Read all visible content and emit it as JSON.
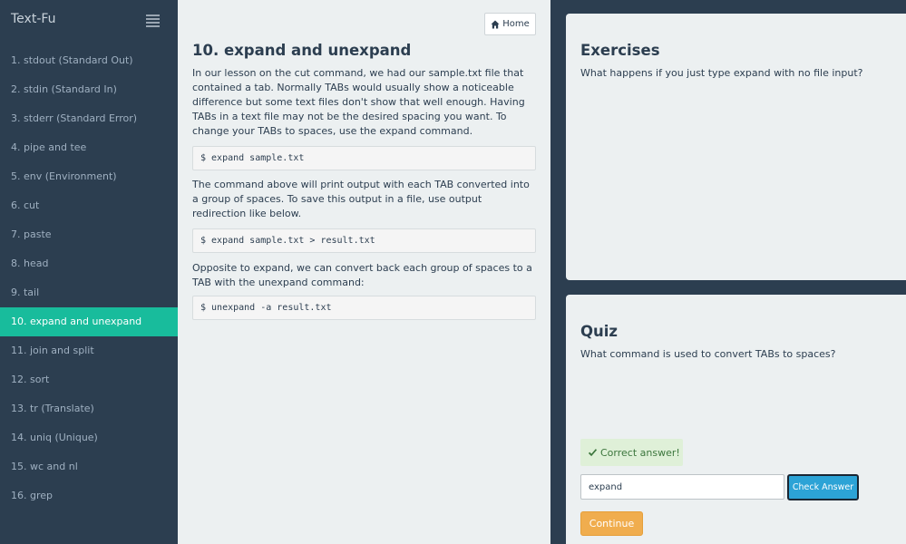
{
  "app": {
    "brand": "Text-Fu"
  },
  "sidebar": {
    "items": [
      {
        "label": "1. stdout (Standard Out)"
      },
      {
        "label": "2. stdin (Standard In)"
      },
      {
        "label": "3. stderr (Standard Error)"
      },
      {
        "label": "4. pipe and tee"
      },
      {
        "label": "5. env (Environment)"
      },
      {
        "label": "6. cut"
      },
      {
        "label": "7. paste"
      },
      {
        "label": "8. head"
      },
      {
        "label": "9. tail"
      },
      {
        "label": "10. expand and unexpand",
        "active": true
      },
      {
        "label": "11. join and split"
      },
      {
        "label": "12. sort"
      },
      {
        "label": "13. tr (Translate)"
      },
      {
        "label": "14. uniq (Unique)"
      },
      {
        "label": "15. wc and nl"
      },
      {
        "label": "16. grep"
      }
    ]
  },
  "lesson": {
    "home_label": "Home",
    "title": "10. expand and unexpand",
    "p1": "In our lesson on the cut command, we had our sample.txt file that contained a tab. Normally TABs would usually show a noticeable difference but some text files don't show that well enough. Having TABs in a text file may not be the desired spacing you want. To change your TABs to spaces, use the expand command.",
    "code1": "$ expand sample.txt",
    "p2": "The command above will print output with each TAB converted into a group of spaces. To save this output in a file, use output redirection like below.",
    "code2": "$ expand sample.txt > result.txt",
    "p3": "Opposite to expand, we can convert back each group of spaces to a TAB with the unexpand command:",
    "code3": "$ unexpand -a result.txt"
  },
  "exercises": {
    "title": "Exercises",
    "question": "What happens if you just type expand with no file input?"
  },
  "quiz": {
    "title": "Quiz",
    "question": "What command is used to convert TABs to spaces?",
    "feedback": "Correct answer!",
    "answer_value": "expand",
    "check_label": "Check Answer",
    "continue_label": "Continue"
  },
  "colors": {
    "sidebar_bg": "#2c3e50",
    "active_item": "#18bc9c",
    "panel_bg": "#ecf0f1",
    "success_bg": "#dff0d8",
    "info_button": "#2ca3d6",
    "warning_button": "#f0ad4e"
  },
  "icons": {
    "menu_toggle": "hamburger-icon",
    "home": "home-icon",
    "feedback": "check-icon"
  }
}
